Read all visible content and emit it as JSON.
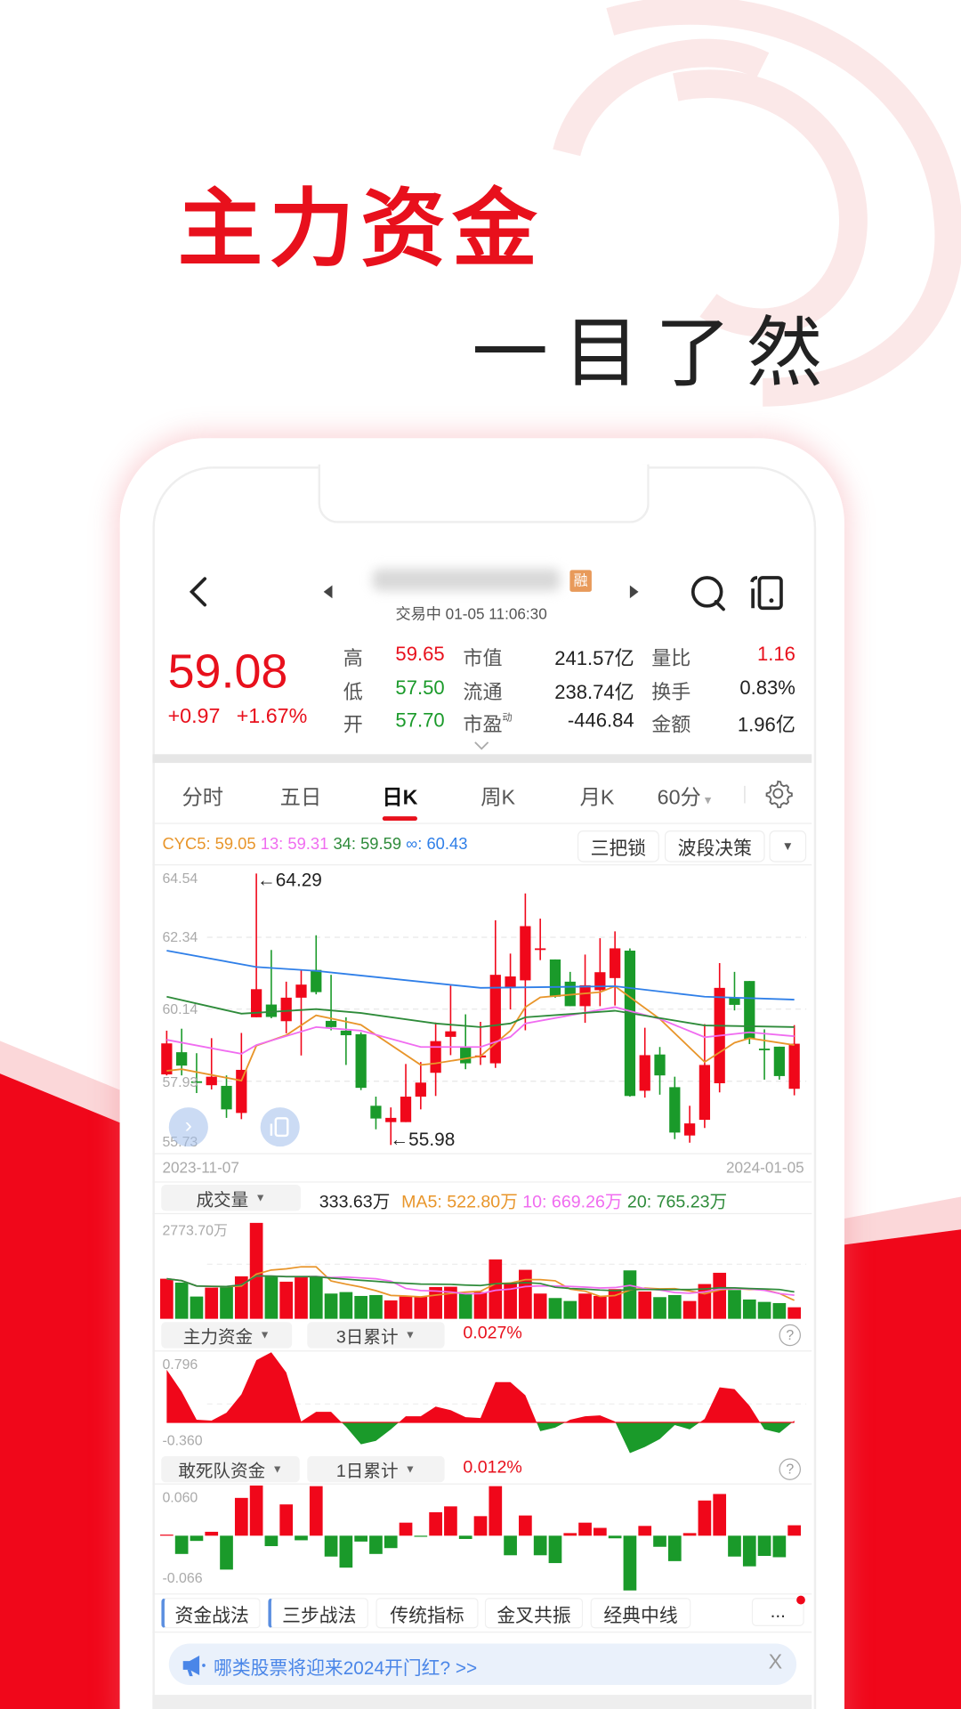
{
  "promo": {
    "headline": "主力资金",
    "subline": "一目了然"
  },
  "header": {
    "status_time": "交易中 01-05 11:06:30",
    "badge": "融"
  },
  "quote": {
    "price": "59.08",
    "change": "+0.97",
    "change_pct": "+1.67%",
    "stats": [
      {
        "label": "高",
        "value": "59.65",
        "color": "red"
      },
      {
        "label": "低",
        "value": "57.50",
        "color": "green"
      },
      {
        "label": "开",
        "value": "57.70",
        "color": "green"
      }
    ],
    "stats2": [
      {
        "label": "市值",
        "value": "241.57亿"
      },
      {
        "label": "流通",
        "value": "238.74亿"
      },
      {
        "label": "市盈",
        "sup": "动",
        "value": "-446.84"
      }
    ],
    "stats3": [
      {
        "label": "量比",
        "value": "1.16",
        "color": "red"
      },
      {
        "label": "换手",
        "value": "0.83%"
      },
      {
        "label": "金额",
        "value": "1.96亿"
      }
    ]
  },
  "tabs": [
    {
      "label": "分时"
    },
    {
      "label": "五日"
    },
    {
      "label": "日K",
      "active": true
    },
    {
      "label": "周K"
    },
    {
      "label": "月K"
    },
    {
      "label": "60分"
    }
  ],
  "indicators": {
    "cyc5": "CYC5: 59.05",
    "cyc13": "13: 59.31",
    "cyc34": "34: 59.59",
    "cycinf": "∞: 60.43",
    "btn1": "三把锁",
    "btn2": "波段决策"
  },
  "price_axis": {
    "max": "64.54",
    "l2": "62.34",
    "l3": "60.14",
    "l4": "57.93",
    "min": "55.73",
    "high_mark": "←64.29",
    "low_mark": "←55.98"
  },
  "dates": {
    "start": "2023-11-07",
    "end": "2024-01-05"
  },
  "volume_panel": {
    "selector": "成交量",
    "current": "333.63万",
    "ma5": "MA5: 522.80万",
    "ma10": "10: 669.26万",
    "ma20": "20: 765.23万",
    "axis_max": "2773.70万"
  },
  "main_funds_panel": {
    "selector": "主力资金",
    "period": "3日累计",
    "value": "0.027%",
    "axis_max": "0.796",
    "axis_min": "-0.360"
  },
  "dare_funds_panel": {
    "selector": "敢死队资金",
    "period": "1日累计",
    "value": "0.012%",
    "axis_max": "0.060",
    "axis_min": "-0.066"
  },
  "bottom_tabs": [
    "资金战法",
    "三步战法",
    "传统指标",
    "金叉共振",
    "经典中线",
    "..."
  ],
  "banner": {
    "text": "哪类股票将迎来2024开门红? >>",
    "close": "X"
  },
  "colors": {
    "up": "#f0071a",
    "down": "#1a9a2a",
    "accent": "#e8101c",
    "cyc5": "#e8952a",
    "cyc13": "#f06cf0",
    "cyc34": "#2e8b3a",
    "cycinf": "#2f7fe8",
    "banner_text": "#4a86e8"
  },
  "icons": [
    "back-chevron-icon",
    "prev-stock-icon",
    "next-stock-icon",
    "search-icon",
    "layout-icon",
    "expand-chevron-icon",
    "gear-icon",
    "help-icon",
    "megaphone-icon",
    "close-icon"
  ],
  "chart_data": [
    {
      "type": "candlestick",
      "ylim": [
        55.73,
        64.54
      ],
      "x_range": [
        "2023-11-07",
        "2024-01-05"
      ],
      "ohlc": [
        [
          58.14,
          59.48,
          58.11,
          59.09
        ],
        [
          58.82,
          59.54,
          58.11,
          58.41
        ],
        [
          57.93,
          58.79,
          57.57,
          57.91
        ],
        [
          57.81,
          59.25,
          57.68,
          58.07
        ],
        [
          57.79,
          58.11,
          56.81,
          57.07
        ],
        [
          56.96,
          59.41,
          56.77,
          58.28
        ],
        [
          59.89,
          64.29,
          59.89,
          60.75
        ],
        [
          60.28,
          61.95,
          59.86,
          59.9
        ],
        [
          59.77,
          60.98,
          59.4,
          60.49
        ],
        [
          60.49,
          61.34,
          58.72,
          60.89
        ],
        [
          61.34,
          62.4,
          60.59,
          60.66
        ],
        [
          59.78,
          61.19,
          59.49,
          59.59
        ],
        [
          59.48,
          59.89,
          58.43,
          59.34
        ],
        [
          59.37,
          59.43,
          57.66,
          57.73
        ],
        [
          57.18,
          57.46,
          56.46,
          56.79
        ],
        [
          56.68,
          57.13,
          55.98,
          56.81
        ],
        [
          56.68,
          58.46,
          56.68,
          57.46
        ],
        [
          57.46,
          58.52,
          57.07,
          57.89
        ],
        [
          58.19,
          59.73,
          57.48,
          59.16
        ],
        [
          59.29,
          60.86,
          58.73,
          59.46
        ],
        [
          58.98,
          59.98,
          58.3,
          58.48
        ],
        [
          58.66,
          59.75,
          58.43,
          58.72
        ],
        [
          58.48,
          62.86,
          58.34,
          61.19
        ],
        [
          60.79,
          61.84,
          60.13,
          61.14
        ],
        [
          61.02,
          63.68,
          59.49,
          62.68
        ],
        [
          61.96,
          62.91,
          61.64,
          62.0
        ],
        [
          61.66,
          61.66,
          60.49,
          60.52
        ],
        [
          60.98,
          61.28,
          60.23,
          60.23
        ],
        [
          60.23,
          61.81,
          59.72,
          60.87
        ],
        [
          60.72,
          62.31,
          60.23,
          61.27
        ],
        [
          61.09,
          62.52,
          60.25,
          62.0
        ],
        [
          61.93,
          62.0,
          57.46,
          57.48
        ],
        [
          57.64,
          59.57,
          57.43,
          58.73
        ],
        [
          58.75,
          58.98,
          57.52,
          58.11
        ],
        [
          57.75,
          58.07,
          56.16,
          56.36
        ],
        [
          56.27,
          57.18,
          56.05,
          56.64
        ],
        [
          56.75,
          59.68,
          56.5,
          58.43
        ],
        [
          57.87,
          61.55,
          57.59,
          60.79
        ],
        [
          60.48,
          61.28,
          60.1,
          60.27
        ],
        [
          61.0,
          61.0,
          59.07,
          59.23
        ],
        [
          58.93,
          59.52,
          57.98,
          58.91
        ],
        [
          58.99,
          58.99,
          57.98,
          58.09
        ],
        [
          57.7,
          59.65,
          57.5,
          59.08
        ]
      ],
      "lines": [
        {
          "name": "CYC5",
          "color": "#e8952a",
          "points": [
            [
              1,
              58.25
            ],
            [
              2,
              58.3
            ],
            [
              6,
              57.95
            ],
            [
              7,
              59.02
            ],
            [
              9,
              59.34
            ],
            [
              11,
              59.95
            ],
            [
              14,
              59.66
            ],
            [
              18,
              58.43
            ],
            [
              19,
              58.48
            ],
            [
              22,
              58.7
            ],
            [
              24,
              59.48
            ],
            [
              25,
              60.2
            ],
            [
              26,
              60.5
            ],
            [
              30,
              60.66
            ],
            [
              31,
              60.84
            ],
            [
              34,
              59.84
            ],
            [
              37,
              58.52
            ],
            [
              39,
              59.11
            ],
            [
              40,
              59.25
            ],
            [
              43,
              59.04
            ]
          ]
        },
        {
          "name": "13",
          "color": "#f06cf0",
          "points": [
            [
              1,
              59.2
            ],
            [
              6,
              58.77
            ],
            [
              7,
              59.04
            ],
            [
              11,
              59.59
            ],
            [
              14,
              59.48
            ],
            [
              18,
              58.98
            ],
            [
              22,
              58.98
            ],
            [
              24,
              59.29
            ],
            [
              25,
              59.7
            ],
            [
              31,
              60.2
            ],
            [
              34,
              59.84
            ],
            [
              37,
              59.28
            ],
            [
              40,
              59.43
            ],
            [
              43,
              59.31
            ]
          ]
        },
        {
          "name": "34",
          "color": "#2e8b3a",
          "points": [
            [
              1,
              60.52
            ],
            [
              6,
              60.0
            ],
            [
              11,
              60.14
            ],
            [
              14,
              60.02
            ],
            [
              19,
              59.7
            ],
            [
              22,
              59.59
            ],
            [
              24,
              59.7
            ],
            [
              25,
              59.89
            ],
            [
              31,
              60.09
            ],
            [
              37,
              59.64
            ],
            [
              43,
              59.59
            ]
          ]
        },
        {
          "name": "∞",
          "color": "#2f7fe8",
          "points": [
            [
              1,
              61.93
            ],
            [
              7,
              61.43
            ],
            [
              11,
              61.31
            ],
            [
              22,
              60.79
            ],
            [
              31,
              60.84
            ],
            [
              37,
              60.52
            ],
            [
              43,
              60.43
            ]
          ]
        }
      ]
    },
    {
      "type": "bar",
      "unit": "万",
      "ylim": [
        0,
        2773.7
      ],
      "values": [
        1159,
        1048,
        644,
        902,
        919,
        1228,
        2774,
        1228,
        1073,
        1219,
        1219,
        730,
        773,
        661,
        687,
        532,
        644,
        644,
        919,
        927,
        730,
        773,
        1717,
        1030,
        1417,
        730,
        601,
        515,
        730,
        661,
        859,
        1400,
        790,
        627,
        687,
        515,
        1005,
        1331,
        833,
        558,
        489,
        455,
        333.63
      ]
    },
    {
      "type": "area",
      "ylim": [
        -0.36,
        0.796
      ],
      "values": [
        0.6,
        0.35,
        0.03,
        0.02,
        0.11,
        0.32,
        0.71,
        0.8,
        0.57,
        0.01,
        0.12,
        0.12,
        -0.05,
        -0.25,
        -0.21,
        -0.08,
        0.07,
        0.07,
        0.18,
        0.14,
        0.06,
        0.05,
        0.46,
        0.46,
        0.31,
        -0.1,
        -0.06,
        0.03,
        0.07,
        0.08,
        0.01,
        -0.35,
        -0.28,
        -0.19,
        -0.03,
        -0.08,
        0.04,
        0.4,
        0.38,
        0.19,
        -0.08,
        -0.12,
        0.02
      ]
    },
    {
      "type": "bar",
      "ylim": [
        -0.066,
        0.06
      ],
      "values": [
        0.001,
        -0.028,
        -0.008,
        0.006,
        -0.052,
        0.058,
        0.077,
        -0.016,
        0.048,
        -0.007,
        0.076,
        -0.032,
        -0.049,
        -0.009,
        -0.028,
        -0.019,
        0.02,
        -0.001,
        0.036,
        0.045,
        -0.005,
        0.03,
        0.076,
        -0.03,
        0.031,
        -0.03,
        -0.042,
        0.004,
        0.02,
        0.012,
        -0.004,
        -0.084,
        0.015,
        -0.017,
        -0.039,
        0.004,
        0.054,
        0.064,
        -0.032,
        -0.047,
        -0.031,
        -0.033,
        0.016
      ]
    }
  ]
}
